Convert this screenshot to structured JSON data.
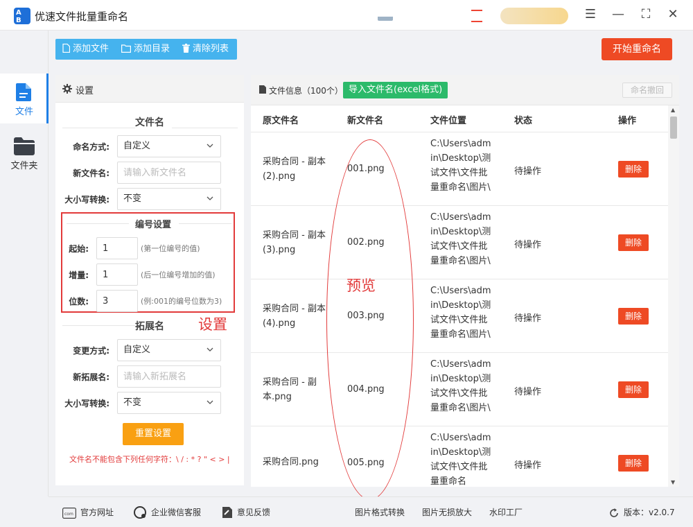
{
  "app": {
    "title": "优速文件批量重命名",
    "logo_text": "A B"
  },
  "window_controls": {
    "menu": "☰",
    "minimize": "—",
    "maximize": "⛶",
    "close": "✕"
  },
  "nav": [
    {
      "label": "文件",
      "icon": "file-icon",
      "active": true
    },
    {
      "label": "文件夹",
      "icon": "folder-icon",
      "active": false
    }
  ],
  "toolbar": {
    "add_file": "添加文件",
    "add_dir": "添加目录",
    "clear_list": "清除列表",
    "start": "开始重命名"
  },
  "settings": {
    "header": "设置",
    "filename_section": "文件名",
    "naming_mode_label": "命名方式:",
    "naming_mode_value": "自定义",
    "new_name_label": "新文件名:",
    "new_name_placeholder": "请输入新文件名",
    "case_label": "大小写转换:",
    "case_value": "不变",
    "numbering_section": "编号设置",
    "start_label": "起始:",
    "start_value": "1",
    "start_hint": "(第一位编号的值)",
    "inc_label": "增量:",
    "inc_value": "1",
    "inc_hint": "(后一位编号增加的值)",
    "digits_label": "位数:",
    "digits_value": "3",
    "digits_hint": "(例:001的编号位数为3)",
    "ext_section": "拓展名",
    "ext_mode_label": "变更方式:",
    "ext_mode_value": "自定义",
    "new_ext_label": "新拓展名:",
    "new_ext_placeholder": "请输入新拓展名",
    "ext_case_label": "大小写转换:",
    "ext_case_value": "不变",
    "reset": "重置设置",
    "warning": "文件名不能包含下列任何字符：\\ / : * ? \" < > |"
  },
  "annotations": {
    "settings": "设置",
    "preview": "预览"
  },
  "files": {
    "info_label": "文件信息（100个）",
    "import_btn": "导入文件名(excel格式)",
    "undo_btn": "命名撤回",
    "columns": [
      "原文件名",
      "新文件名",
      "文件位置",
      "状态",
      "操作"
    ],
    "rows": [
      {
        "orig": "采购合同 - 副本 (2).png",
        "new": "001.png",
        "loc": "C:\\Users\\admin\\Desktop\\测试文件\\文件批量重命名\\图片\\",
        "status": "待操作",
        "action": "删除"
      },
      {
        "orig": "采购合同 - 副本 (3).png",
        "new": "002.png",
        "loc": "C:\\Users\\admin\\Desktop\\测试文件\\文件批量重命名\\图片\\",
        "status": "待操作",
        "action": "删除"
      },
      {
        "orig": "采购合同 - 副本 (4).png",
        "new": "003.png",
        "loc": "C:\\Users\\admin\\Desktop\\测试文件\\文件批量重命名\\图片\\",
        "status": "待操作",
        "action": "删除"
      },
      {
        "orig": "采购合同 - 副本.png",
        "new": "004.png",
        "loc": "C:\\Users\\admin\\Desktop\\测试文件\\文件批量重命名\\图片\\",
        "status": "待操作",
        "action": "删除"
      },
      {
        "orig": "采购合同.png",
        "new": "005.png",
        "loc": "C:\\Users\\admin\\Desktop\\测试文件\\文件批量重命名",
        "status": "待操作",
        "action": "删除"
      }
    ]
  },
  "footer": {
    "website": "官方网址",
    "wechat": "企业微信客服",
    "feedback": "意见反馈",
    "format_convert": "图片格式转换",
    "lossless": "图片无损放大",
    "watermark": "水印工厂",
    "version": "版本：v2.0.7"
  },
  "colors": {
    "primary_blue": "#45b3ee",
    "accent_red": "#ee4a24",
    "import_green": "#2cba6a",
    "reset_orange": "#f9a012",
    "annotation_red": "#e23a3a"
  }
}
